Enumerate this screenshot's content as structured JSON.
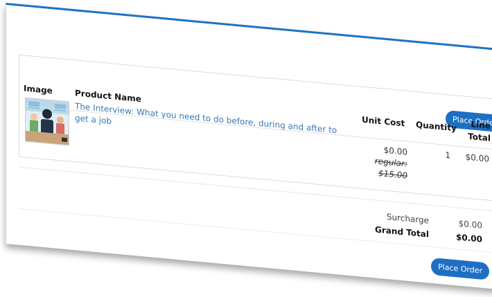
{
  "cart": {
    "place_order_label": "Place Order",
    "columns": {
      "image": "Image",
      "product_name": "Product Name",
      "unit_cost": "Unit Cost",
      "quantity": "Quantity",
      "line_total_1": "Line",
      "line_total_2": "Total"
    },
    "item": {
      "name": "The Interview: What you need to do before, during and after to get a job",
      "unit_cost": "$0.00",
      "regular_label": "regular:",
      "regular_price": "$15.00",
      "quantity": "1",
      "line_total": "$0.00",
      "thumbnail_icon": "interview-illustration-icon"
    },
    "totals": {
      "surcharge_label": "Surcharge",
      "surcharge_value": "$0.00",
      "grand_total_label": "Grand Total",
      "grand_total_value": "$0.00"
    },
    "colors": {
      "accent": "#1d6fc4",
      "link": "#3a78b5"
    }
  }
}
